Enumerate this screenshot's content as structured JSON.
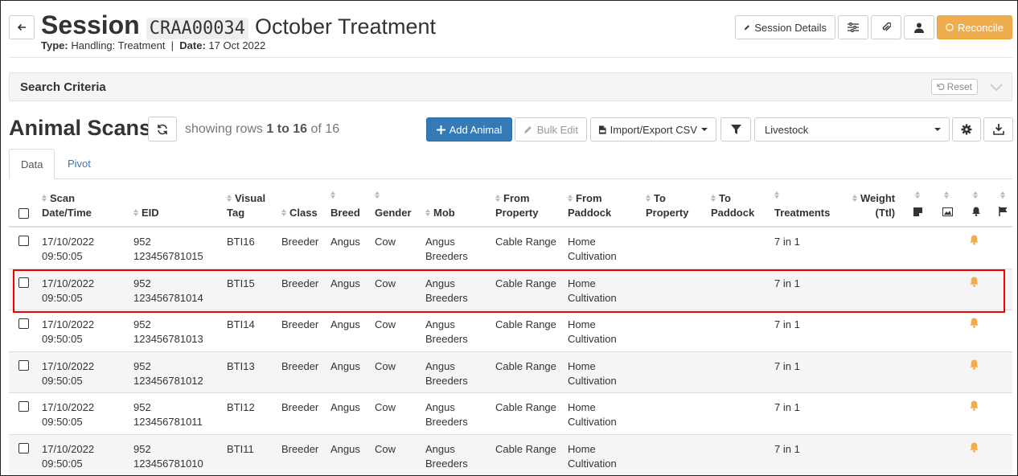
{
  "header": {
    "title_prefix": "Session",
    "session_code": "CRAA00034",
    "title_suffix": "October Treatment",
    "type_label": "Type:",
    "type_value": "Handling: Treatment",
    "separator": "|",
    "date_label": "Date:",
    "date_value": "17 Oct 2022",
    "buttons": {
      "session_details": "Session Details",
      "reconcile": "Reconcile"
    }
  },
  "search": {
    "title": "Search Criteria",
    "reset_label": "Reset"
  },
  "scans": {
    "title": "Animal Scans",
    "showing_prefix": "showing rows",
    "range": "1 to 16",
    "of": "of 16",
    "add_animal": "Add Animal",
    "bulk_edit": "Bulk Edit",
    "import_export": "Import/Export CSV",
    "select_value": "Livestock"
  },
  "tabs": [
    {
      "label": "Data",
      "active": true
    },
    {
      "label": "Pivot",
      "active": false
    }
  ],
  "columns": {
    "scan_line1": "Scan",
    "scan_line2": "Date/Time",
    "eid": "EID",
    "visual_line1": "Visual",
    "visual_line2": "Tag",
    "class": "Class",
    "breed": "Breed",
    "gender": "Gender",
    "mob": "Mob",
    "from_property_1": "From",
    "from_property_2": "Property",
    "from_paddock_1": "From",
    "from_paddock_2": "Paddock",
    "to_property_1": "To",
    "to_property_2": "Property",
    "to_paddock_1": "To",
    "to_paddock_2": "Paddock",
    "treatments": "Treatments",
    "weight_1": "Weight",
    "weight_2": "(Ttl)"
  },
  "rows": [
    {
      "date": "17/10/2022",
      "time": "09:50:05",
      "eid1": "952",
      "eid2": "123456781015",
      "tag": "BTI16",
      "class": "Breeder",
      "breed": "Angus",
      "gender": "Cow",
      "mob1": "Angus",
      "mob2": "Breeders",
      "from_property": "Cable Range",
      "paddock1": "Home",
      "paddock2": "Cultivation",
      "treatments": "7 in 1"
    },
    {
      "date": "17/10/2022",
      "time": "09:50:05",
      "eid1": "952",
      "eid2": "123456781014",
      "tag": "BTI15",
      "class": "Breeder",
      "breed": "Angus",
      "gender": "Cow",
      "mob1": "Angus",
      "mob2": "Breeders",
      "from_property": "Cable Range",
      "paddock1": "Home",
      "paddock2": "Cultivation",
      "treatments": "7 in 1"
    },
    {
      "date": "17/10/2022",
      "time": "09:50:05",
      "eid1": "952",
      "eid2": "123456781013",
      "tag": "BTI14",
      "class": "Breeder",
      "breed": "Angus",
      "gender": "Cow",
      "mob1": "Angus",
      "mob2": "Breeders",
      "from_property": "Cable Range",
      "paddock1": "Home",
      "paddock2": "Cultivation",
      "treatments": "7 in 1"
    },
    {
      "date": "17/10/2022",
      "time": "09:50:05",
      "eid1": "952",
      "eid2": "123456781012",
      "tag": "BTI13",
      "class": "Breeder",
      "breed": "Angus",
      "gender": "Cow",
      "mob1": "Angus",
      "mob2": "Breeders",
      "from_property": "Cable Range",
      "paddock1": "Home",
      "paddock2": "Cultivation",
      "treatments": "7 in 1"
    },
    {
      "date": "17/10/2022",
      "time": "09:50:05",
      "eid1": "952",
      "eid2": "123456781011",
      "tag": "BTI12",
      "class": "Breeder",
      "breed": "Angus",
      "gender": "Cow",
      "mob1": "Angus",
      "mob2": "Breeders",
      "from_property": "Cable Range",
      "paddock1": "Home",
      "paddock2": "Cultivation",
      "treatments": "7 in 1"
    },
    {
      "date": "17/10/2022",
      "time": "09:50:05",
      "eid1": "952",
      "eid2": "123456781010",
      "tag": "BTI11",
      "class": "Breeder",
      "breed": "Angus",
      "gender": "Cow",
      "mob1": "Angus",
      "mob2": "Breeders",
      "from_property": "Cable Range",
      "paddock1": "Home",
      "paddock2": "Cultivation",
      "treatments": "7 in 1"
    }
  ],
  "colors": {
    "primary": "#337ab7",
    "warning": "#f0ad4e",
    "bell": "#f0ad4e",
    "highlight": "#e00000"
  }
}
